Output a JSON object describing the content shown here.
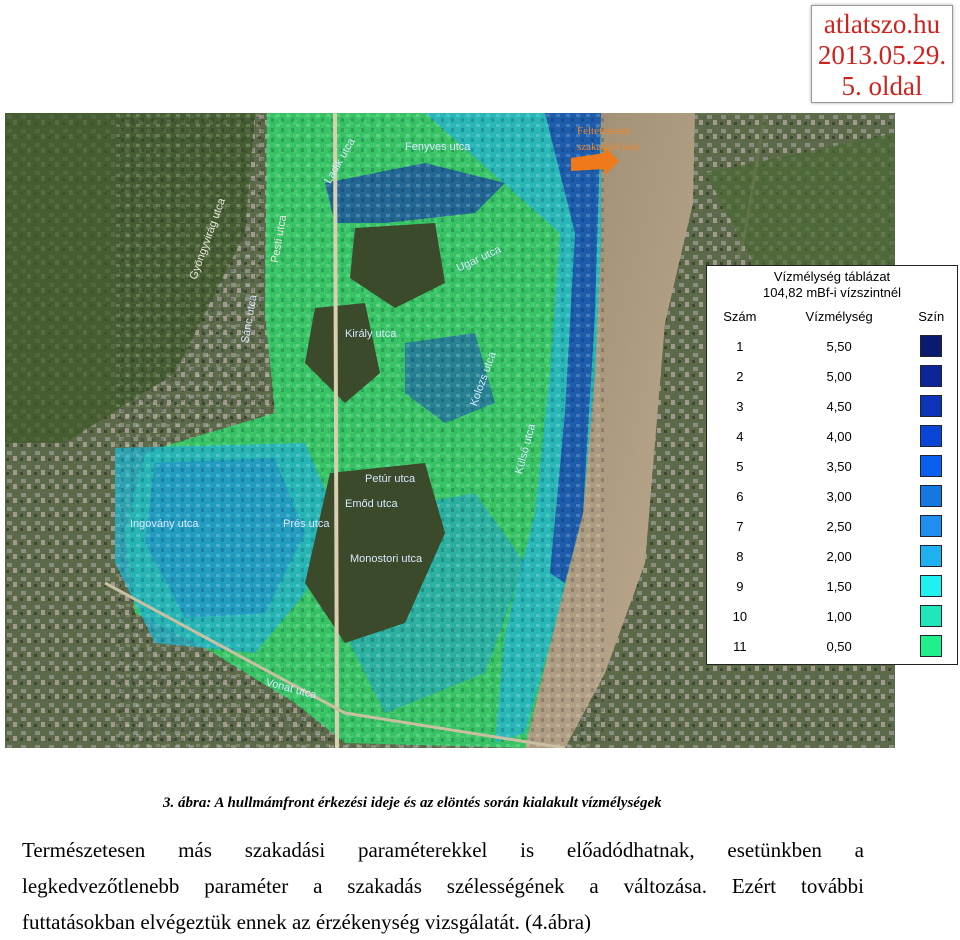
{
  "stamp": {
    "line1": "atlatszo.hu",
    "line2": "2013.05.29.",
    "line3": "5. oldal",
    "color": "#d0211c"
  },
  "map": {
    "breach_label_1": "Feltételezett",
    "breach_label_2": "szakadási hely",
    "street_labels": [
      "Fenyves utca",
      "Ugar utca",
      "Ladik utca",
      "Király utca",
      "Petúr utca",
      "Emőd utca",
      "Prés utca",
      "Monostori utca",
      "Ingovány utca",
      "Vonat utca",
      "Kolozs utca",
      "Külső utca",
      "Sánc utca",
      "Gyöngyvirág utca",
      "Pesti utca"
    ],
    "colors": {
      "water_deep": "#1a3fa8",
      "water_mid": "#22a0c8",
      "water_shallow": "#2ed66a",
      "river": "#b8a48a"
    }
  },
  "legend": {
    "title_1": "Vízmélység táblázat",
    "title_2": "104,82 mBf-i vízszintnél",
    "col_num": "Szám",
    "col_depth": "Vízmélység",
    "col_color": "Szín",
    "rows": [
      {
        "num": "1",
        "depth": "5,50",
        "color": "#0a1a6e"
      },
      {
        "num": "2",
        "depth": "5,00",
        "color": "#0b2696"
      },
      {
        "num": "3",
        "depth": "4,50",
        "color": "#0b34b8"
      },
      {
        "num": "4",
        "depth": "4,00",
        "color": "#0a45d6"
      },
      {
        "num": "5",
        "depth": "3,50",
        "color": "#0b5fee"
      },
      {
        "num": "6",
        "depth": "3,00",
        "color": "#1478e0"
      },
      {
        "num": "7",
        "depth": "2,50",
        "color": "#1f8ef0"
      },
      {
        "num": "8",
        "depth": "2,00",
        "color": "#1fb0f0"
      },
      {
        "num": "9",
        "depth": "1,50",
        "color": "#1ff0f0"
      },
      {
        "num": "10",
        "depth": "1,00",
        "color": "#1fe6b8"
      },
      {
        "num": "11",
        "depth": "0,50",
        "color": "#1ff08a"
      }
    ]
  },
  "caption": "3. ábra: A hullmámfront érkezési ideje és az elöntés során kialakult vízmélységek",
  "paragraph": {
    "line1": "Természetesen más szakadási paraméterekkel is előadódhatnak, esetünkben a",
    "line2": "legkedvezőtlenebb paraméter a szakadás szélességének a változása. Ezért további",
    "line3": "futtatásokban elvégeztük ennek az érzékenység vizsgálatát. (4.ábra)"
  }
}
